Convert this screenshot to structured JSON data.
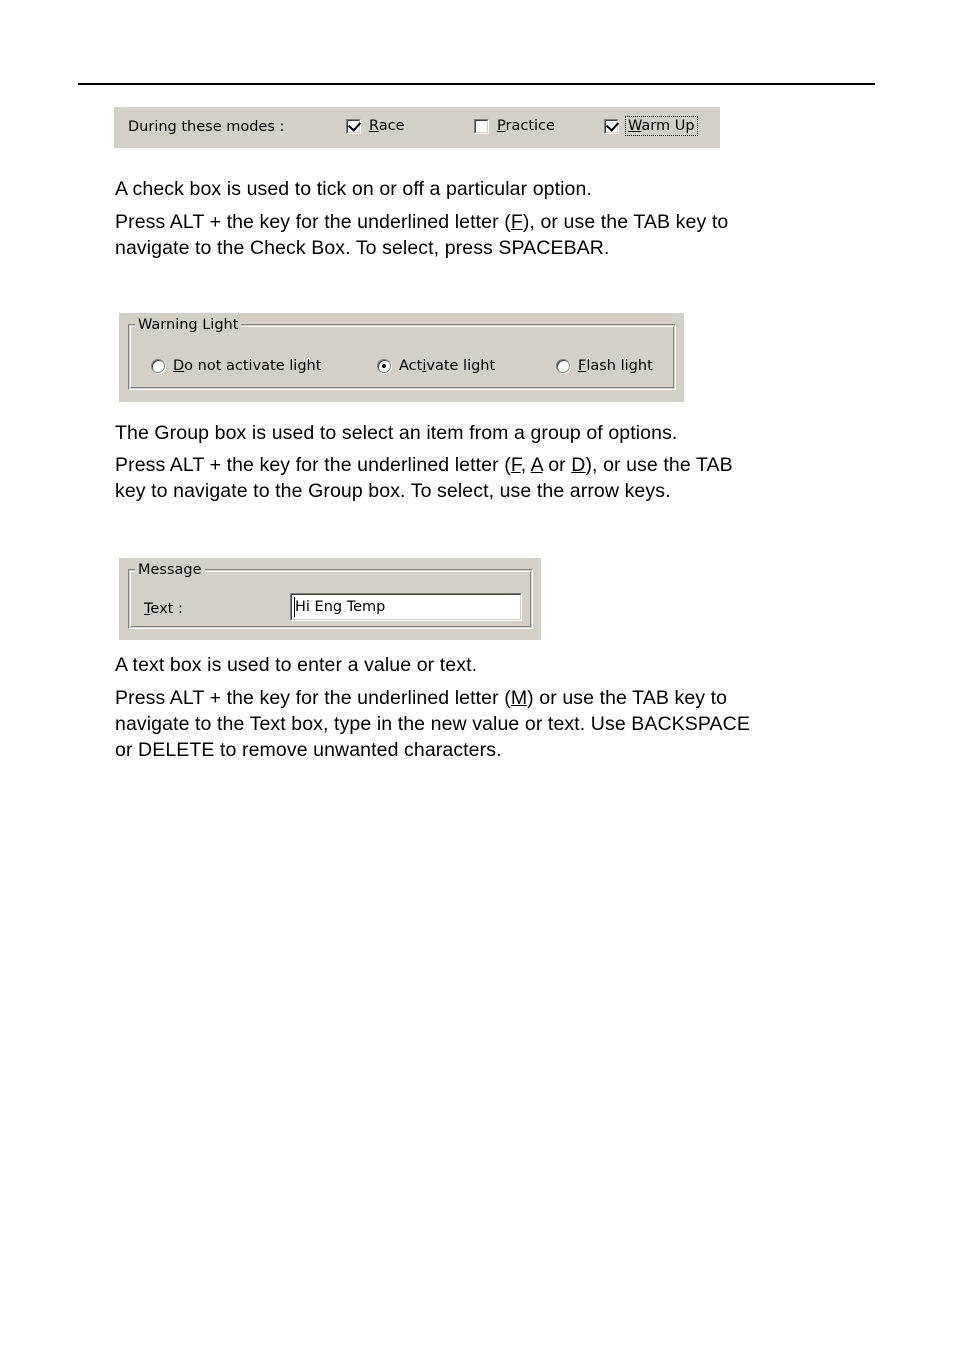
{
  "page": {
    "background": "#ffffff",
    "rule_color": "#000000"
  },
  "dialog_theme": {
    "face": "#d4d0c8",
    "shadow": "#808080",
    "highlight": "#ffffff",
    "field": "#ffffff",
    "text": "#000000"
  },
  "checkbox_demo": {
    "prompt": "During these modes :",
    "items": [
      {
        "accel": "R",
        "pre": "",
        "post": "ace",
        "label": "Race",
        "checked": true,
        "focused": false
      },
      {
        "accel": "P",
        "pre": "",
        "post": "ractice",
        "label": "Practice",
        "checked": false,
        "focused": false
      },
      {
        "accel": "W",
        "pre": "",
        "post": "arm Up",
        "label": "Warm Up",
        "checked": true,
        "focused": true
      }
    ]
  },
  "checkbox_text": {
    "line1": "A check box is used to tick on or off a particular option.",
    "line2_a": "Press ALT + the key for the underlined letter (",
    "line2_accel": "F",
    "line2_b": "), or use the TAB key to",
    "line3": "navigate to the Check Box.  To select, press SPACEBAR."
  },
  "groupbox_demo": {
    "legend": "Warning Light",
    "options": [
      {
        "pre": "D",
        "post": "o not activate light",
        "label": "Do not activate light",
        "selected": false
      },
      {
        "pre": "i",
        "post": "",
        "prefix": "Act",
        "suffix": "vate light",
        "label": "Activate light",
        "selected": true
      },
      {
        "pre": "F",
        "post": "lash light",
        "label": "Flash light",
        "selected": false
      }
    ]
  },
  "groupbox_text": {
    "line1": "The Group box is used to select an item from a group of options.",
    "line2_a": "Press ALT + the key for the underlined letter (",
    "line2_accel1": "F",
    "line2_mid1": ", ",
    "line2_accel2": "A",
    "line2_mid2": " or ",
    "line2_accel3": "D",
    "line2_b": "), or use the TAB",
    "line3": "key to navigate to the Group box. To select, use the arrow keys."
  },
  "textbox_demo": {
    "legend": "Message",
    "label_accel": "T",
    "label_rest": "ext :",
    "value": "Hi Eng Temp",
    "placeholder": ""
  },
  "textbox_text": {
    "line1": "A text box is used to enter a value or text.",
    "line2_a": "Press ALT + the key for the underlined letter (",
    "line2_accel": "M",
    "line2_b": ") or use the TAB key to",
    "line3": "navigate to the Text box, type in the new value or text. Use BACKSPACE",
    "line4": "or DELETE to remove unwanted characters."
  }
}
